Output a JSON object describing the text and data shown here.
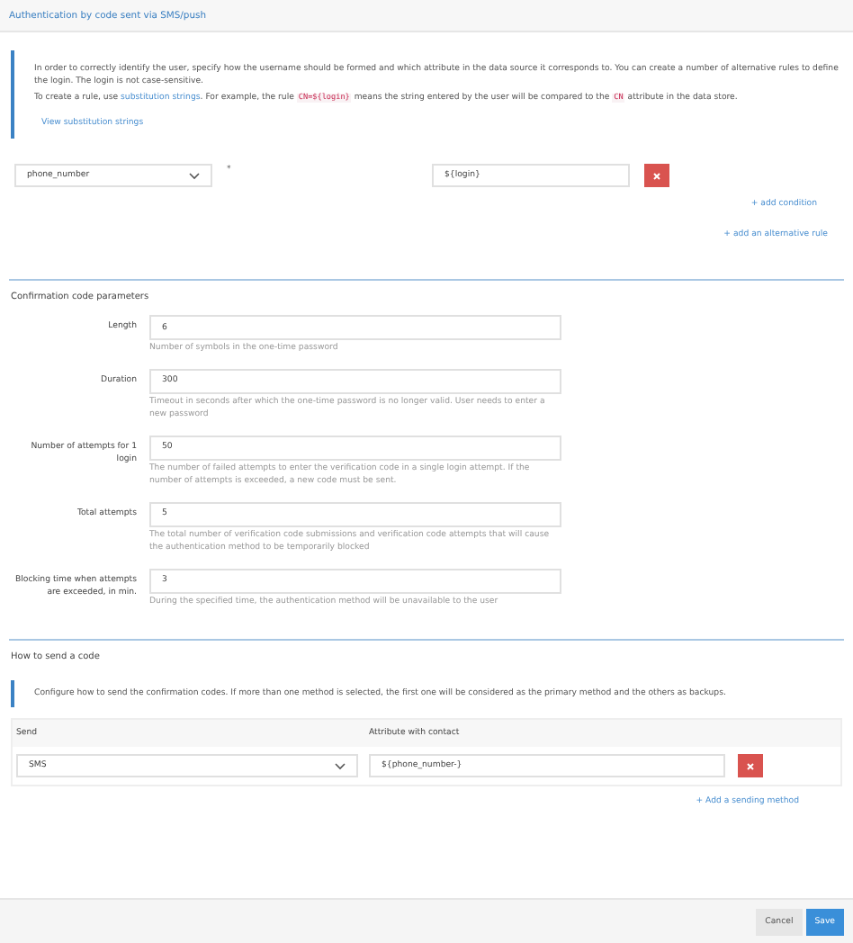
{
  "title": "Authentication by code sent via SMS/push",
  "login_rules": {
    "info": "In order to correctly identify the user, specify how the username should be formed and which attribute in the data source it corresponds to. You can create a number of alternative rules to define the login. The login is not case-sensitive.",
    "example": [
      {
        "kind": "text",
        "text": "To create a rule, use "
      },
      {
        "kind": "link",
        "text": "substitution strings"
      },
      {
        "kind": "text",
        "text": ". For example, the rule "
      },
      {
        "kind": "code",
        "text": "CN=${login}"
      },
      {
        "kind": "text",
        "text": " means the string entered by the user will be compared to the "
      },
      {
        "kind": "code",
        "text": "CN"
      },
      {
        "kind": "text",
        "text": " attribute in the data store."
      }
    ],
    "link": "View substitution strings",
    "rules": [
      {
        "attribute": "phone_number",
        "operator": "*",
        "value": "${login}"
      }
    ],
    "add_condition": "+ add condition",
    "add_rule": "+ add an alternative rule"
  },
  "confirmation": {
    "heading": "Confirmation code parameters",
    "params": [
      {
        "label": "Length",
        "value": "6",
        "help": "Number of symbols in the one-time password"
      },
      {
        "label": "Duration",
        "value": "300",
        "help": "Timeout in seconds after which the one-time password is no longer valid. User needs to enter a new password"
      },
      {
        "label": "Number of attempts for 1 login",
        "value": "50",
        "help": "The number of failed attempts to enter the verification code in a single login attempt. If the number of attempts is exceeded, a new code must be sent."
      },
      {
        "label": "Total attempts",
        "value": "5",
        "help": "The total number of verification code submissions and verification code attempts that will cause the authentication method to be temporarily blocked"
      },
      {
        "label": "Blocking time when attempts are exceeded, in min.",
        "value": "3",
        "help": "During the specified time, the authentication method will be unavailable to the user"
      }
    ]
  },
  "sending": {
    "heading": "How to send a code",
    "info": "Configure how to send the confirmation codes. If more than one method is selected, the first one will be considered as the primary method and the others as backups.",
    "columns": [
      "Send",
      "Attribute with contact"
    ],
    "rows": [
      {
        "method": "SMS",
        "attribute": "${phone_number-}"
      }
    ],
    "add": "+ Add a sending method"
  },
  "buttons": [
    {
      "label": "Cancel",
      "kind": "secondary"
    },
    {
      "label": "Save",
      "kind": "primary"
    }
  ]
}
